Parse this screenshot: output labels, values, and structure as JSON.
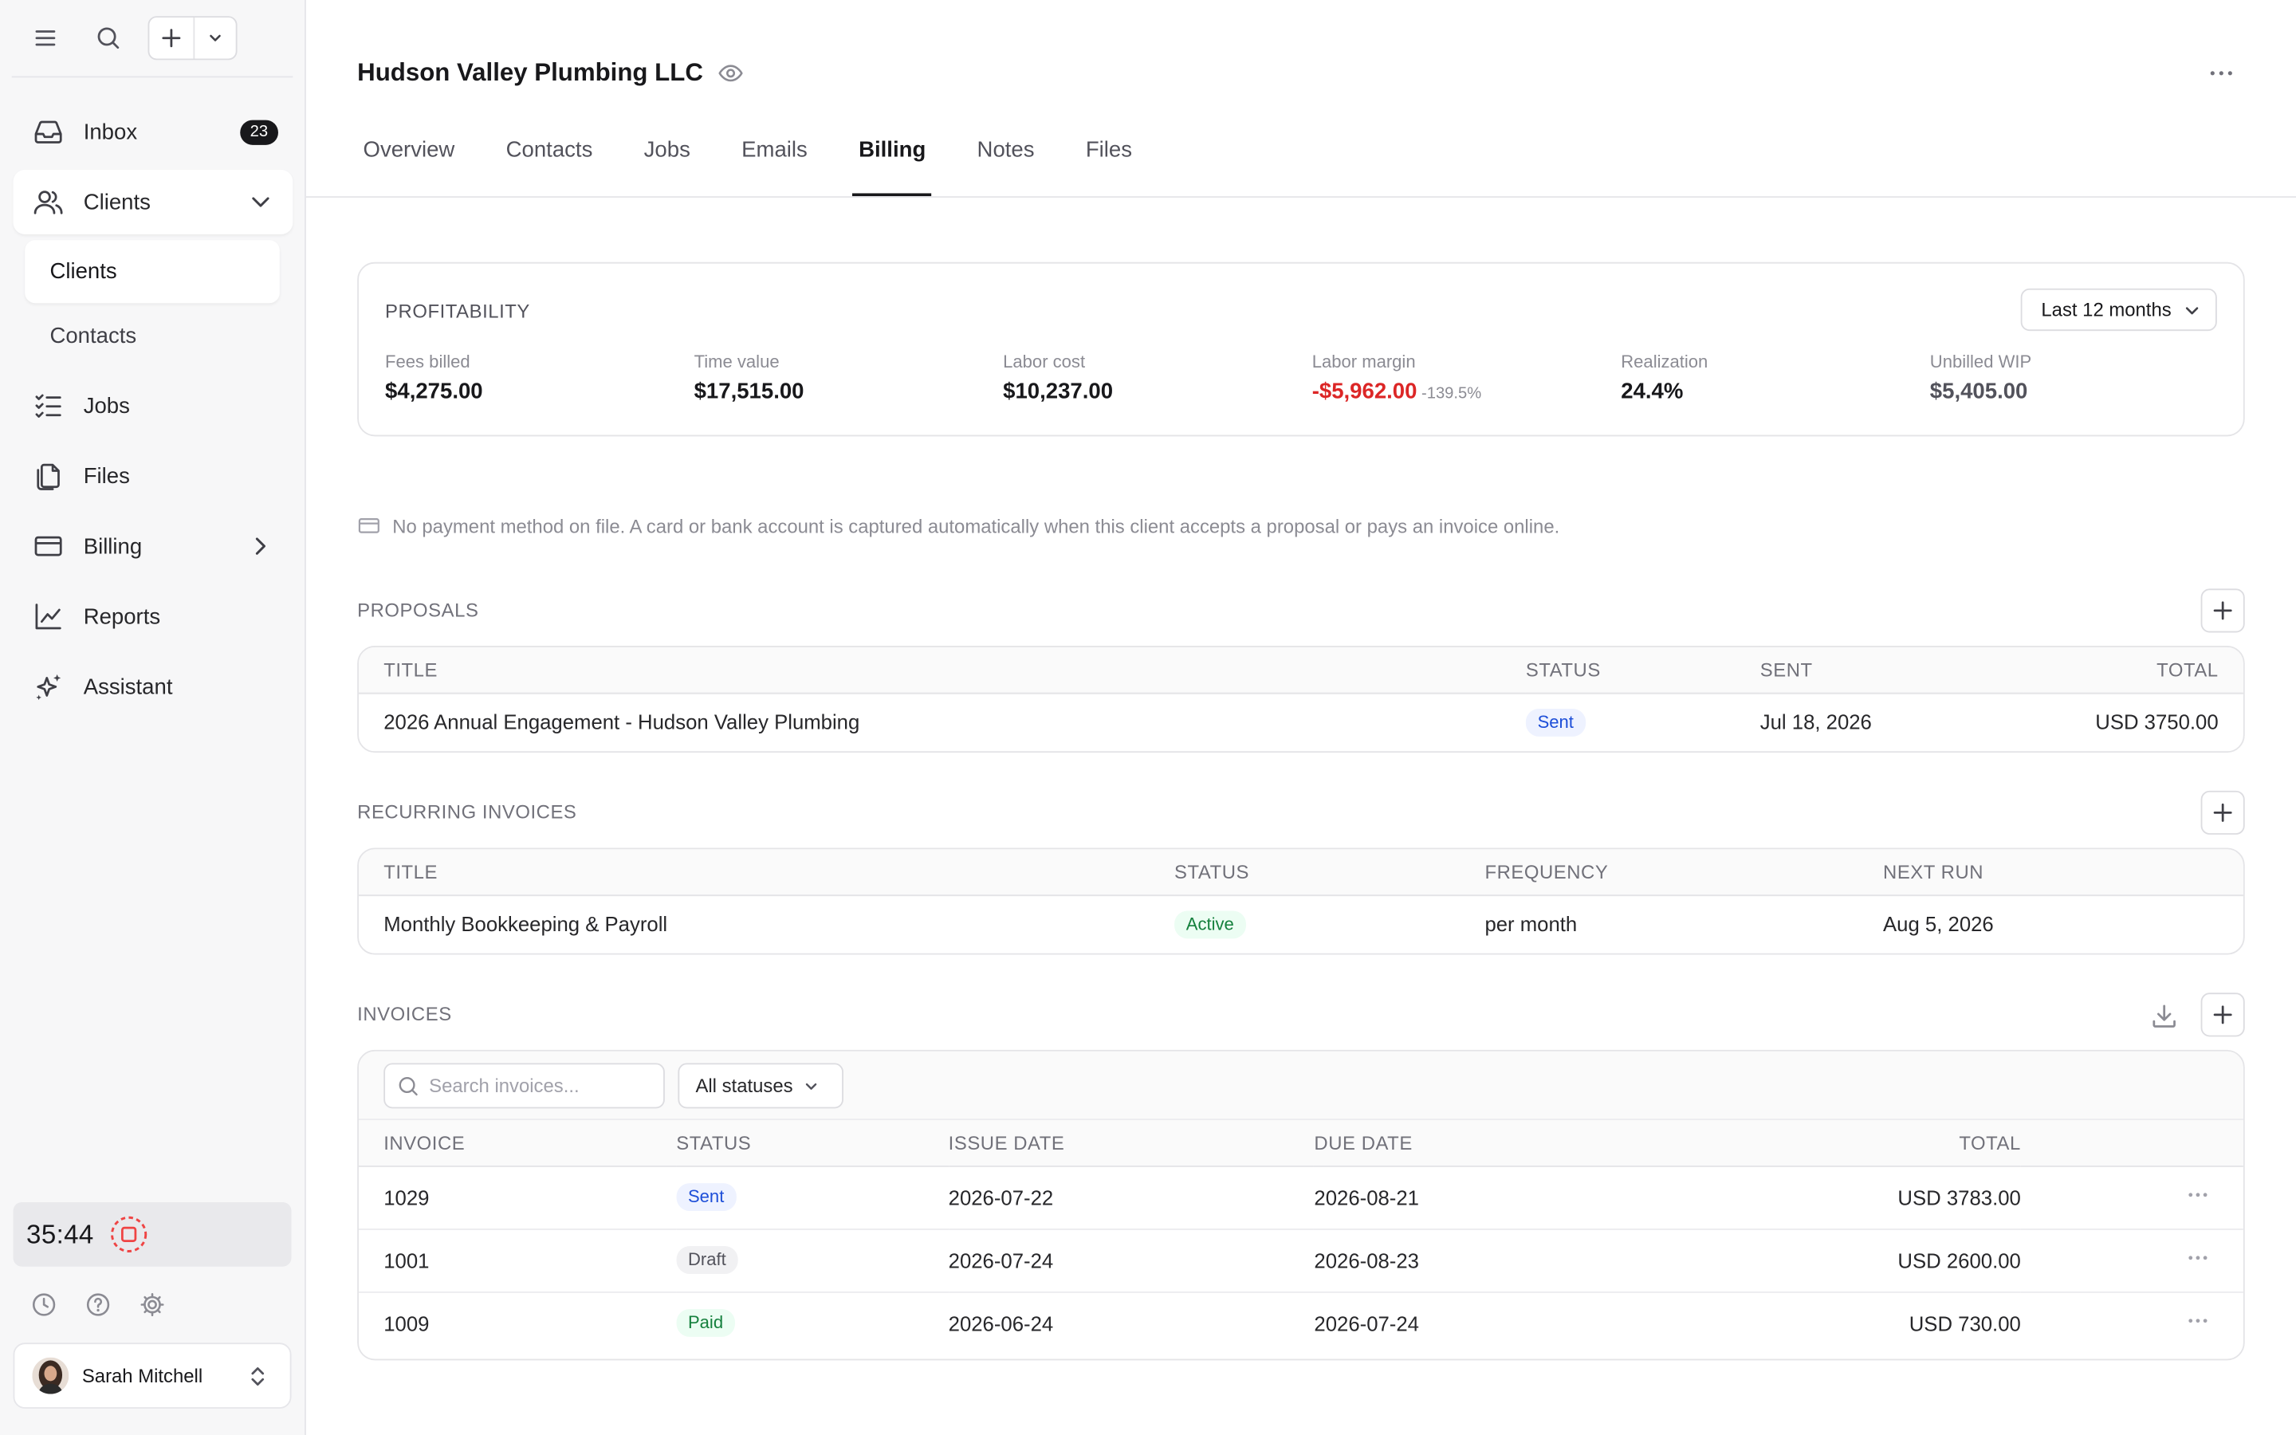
{
  "sidebar": {
    "inbox": {
      "label": "Inbox",
      "badge": "23"
    },
    "clients": {
      "label": "Clients",
      "sub": [
        {
          "label": "Clients"
        },
        {
          "label": "Contacts"
        }
      ]
    },
    "items": [
      {
        "label": "Jobs",
        "icon": "jobs-checklist-icon"
      },
      {
        "label": "Files",
        "icon": "files-icon"
      },
      {
        "label": "Billing",
        "icon": "credit-card-icon"
      },
      {
        "label": "Reports",
        "icon": "chart-line-icon"
      },
      {
        "label": "Assistant",
        "icon": "sparkles-icon"
      }
    ],
    "timer": {
      "value": "35:44"
    },
    "user": {
      "name": "Sarah Mitchell"
    }
  },
  "header": {
    "title": "Hudson Valley Plumbing LLC",
    "tabs": [
      {
        "label": "Overview"
      },
      {
        "label": "Contacts"
      },
      {
        "label": "Jobs"
      },
      {
        "label": "Emails"
      },
      {
        "label": "Billing"
      },
      {
        "label": "Notes"
      },
      {
        "label": "Files"
      }
    ],
    "active_tab": "Billing"
  },
  "profitability": {
    "title": "PROFITABILITY",
    "range": "Last 12 months",
    "metrics": [
      {
        "label": "Fees billed",
        "value": "$4,275.00"
      },
      {
        "label": "Time value",
        "value": "$17,515.00"
      },
      {
        "label": "Labor cost",
        "value": "$10,237.00"
      },
      {
        "label": "Labor margin",
        "value": "-$5,962.00",
        "pct": "-139.5%"
      },
      {
        "label": "Realization",
        "value": "24.4%"
      },
      {
        "label": "Unbilled WIP",
        "value": "$5,405.00"
      }
    ]
  },
  "notice": "No payment method on file. A card or bank account is captured automatically when this client accepts a proposal or pays an invoice online.",
  "proposals": {
    "title": "PROPOSALS",
    "columns": [
      "TITLE",
      "STATUS",
      "SENT",
      "TOTAL"
    ],
    "rows": [
      {
        "title": "2026 Annual Engagement - Hudson Valley Plumbing",
        "status": "Sent",
        "sent": "Jul 18, 2026",
        "total": "USD 3750.00"
      }
    ]
  },
  "recurring": {
    "title": "RECURRING INVOICES",
    "columns": [
      "TITLE",
      "STATUS",
      "FREQUENCY",
      "NEXT RUN"
    ],
    "rows": [
      {
        "title": "Monthly Bookkeeping & Payroll",
        "status": "Active",
        "frequency": "per month",
        "next_run": "Aug 5, 2026"
      }
    ]
  },
  "invoices": {
    "title": "INVOICES",
    "search_placeholder": "Search invoices...",
    "status_filter": "All statuses",
    "columns": [
      "INVOICE",
      "STATUS",
      "ISSUE DATE",
      "DUE DATE",
      "TOTAL"
    ],
    "rows": [
      {
        "invoice": "1029",
        "status": "Sent",
        "issue": "2026-07-22",
        "due": "2026-08-21",
        "total": "USD 3783.00"
      },
      {
        "invoice": "1001",
        "status": "Draft",
        "issue": "2026-07-24",
        "due": "2026-08-23",
        "total": "USD 2600.00"
      },
      {
        "invoice": "1009",
        "status": "Paid",
        "issue": "2026-06-24",
        "due": "2026-07-24",
        "total": "USD 730.00"
      }
    ]
  },
  "colors": {
    "accent": "#18181b",
    "negative": "#dc2626",
    "sent": "#1d4ed8",
    "paid": "#15803d"
  }
}
